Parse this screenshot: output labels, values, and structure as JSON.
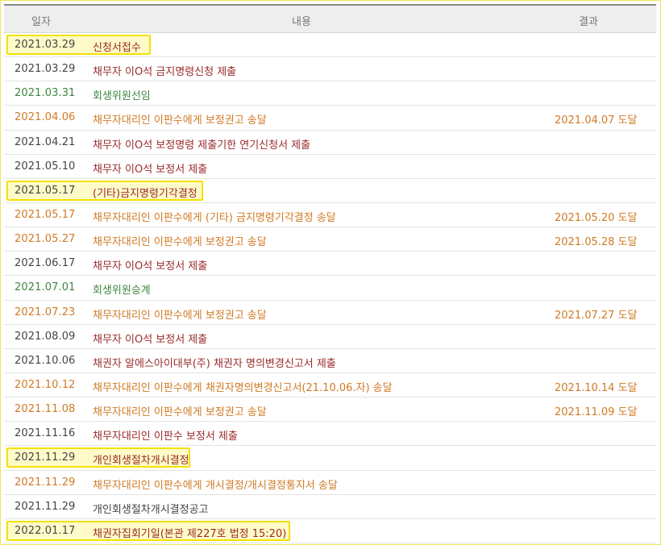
{
  "header": {
    "date": "일자",
    "content": "내용",
    "result": "결과"
  },
  "rows": [
    {
      "date": "2021.03.29",
      "content": "신청서접수",
      "result": "",
      "date_color": "dark",
      "content_color": "red",
      "highlight": true
    },
    {
      "date": "2021.03.29",
      "content": "채무자 이O석 금지명령신청 제출",
      "result": "",
      "date_color": "dark",
      "content_color": "red",
      "highlight": false
    },
    {
      "date": "2021.03.31",
      "content": "회생위원선임",
      "result": "",
      "date_color": "green",
      "content_color": "green",
      "highlight": false
    },
    {
      "date": "2021.04.06",
      "content": "채무자대리인 이판수에게 보정권고 송달",
      "result": "2021.04.07 도달",
      "date_color": "orange",
      "content_color": "orange",
      "highlight": false
    },
    {
      "date": "2021.04.21",
      "content": "채무자 이O석 보정명령 제출기한 연기신청서 제출",
      "result": "",
      "date_color": "dark",
      "content_color": "red",
      "highlight": false
    },
    {
      "date": "2021.05.10",
      "content": "채무자 이O석 보정서 제출",
      "result": "",
      "date_color": "dark",
      "content_color": "red",
      "highlight": false
    },
    {
      "date": "2021.05.17",
      "content": "(기타)금지명령기각결정",
      "result": "",
      "date_color": "dark",
      "content_color": "red",
      "highlight": true
    },
    {
      "date": "2021.05.17",
      "content": "채무자대리인 이판수에게 (기타) 금지명령기각결정 송달",
      "result": "2021.05.20 도달",
      "date_color": "orange",
      "content_color": "orange",
      "highlight": false
    },
    {
      "date": "2021.05.27",
      "content": "채무자대리인 이판수에게 보정권고 송달",
      "result": "2021.05.28 도달",
      "date_color": "orange",
      "content_color": "orange",
      "highlight": false
    },
    {
      "date": "2021.06.17",
      "content": "채무자 이O석 보정서 제출",
      "result": "",
      "date_color": "dark",
      "content_color": "red",
      "highlight": false
    },
    {
      "date": "2021.07.01",
      "content": "회생위원승계",
      "result": "",
      "date_color": "green",
      "content_color": "green",
      "highlight": false
    },
    {
      "date": "2021.07.23",
      "content": "채무자대리인 이판수에게 보정권고 송달",
      "result": "2021.07.27 도달",
      "date_color": "orange",
      "content_color": "orange",
      "highlight": false
    },
    {
      "date": "2021.08.09",
      "content": "채무자 이O석 보정서 제출",
      "result": "",
      "date_color": "dark",
      "content_color": "red",
      "highlight": false
    },
    {
      "date": "2021.10.06",
      "content": "채권자 알에스아이대부(주) 채권자 명의변경신고서 제출",
      "result": "",
      "date_color": "dark",
      "content_color": "red",
      "highlight": false
    },
    {
      "date": "2021.10.12",
      "content": "채무자대리인 이판수에게 채권자명의변경신고서(21.10.06.자) 송달",
      "result": "2021.10.14 도달",
      "date_color": "orange",
      "content_color": "orange",
      "highlight": false
    },
    {
      "date": "2021.11.08",
      "content": "채무자대리인 이판수에게 보정권고 송달",
      "result": "2021.11.09 도달",
      "date_color": "orange",
      "content_color": "orange",
      "highlight": false
    },
    {
      "date": "2021.11.16",
      "content": "채무자대리인 이판수 보정서 제출",
      "result": "",
      "date_color": "dark",
      "content_color": "red",
      "highlight": false
    },
    {
      "date": "2021.11.29",
      "content": "개인회생절차개시결정",
      "result": "",
      "date_color": "dark",
      "content_color": "red",
      "highlight": true
    },
    {
      "date": "2021.11.29",
      "content": "채무자대리인 이판수에게 개시결정/개시결정통지서 송달",
      "result": "",
      "date_color": "orange",
      "content_color": "orange",
      "highlight": false
    },
    {
      "date": "2021.11.29",
      "content": "개인회생절차개시결정공고",
      "result": "",
      "date_color": "dark",
      "content_color": "dark",
      "highlight": false
    },
    {
      "date": "2022.01.17",
      "content": "채권자집회기일(본관 제227호 법정 15:20)",
      "result": "",
      "date_color": "dark",
      "content_color": "red",
      "highlight": true
    }
  ],
  "colors": {
    "orange": "#d07a24",
    "dark": "#444444",
    "green": "#3d8740",
    "red": "#9b2a2a",
    "highlight_border": "#f5e000",
    "highlight_fill": "#fffbc9"
  }
}
